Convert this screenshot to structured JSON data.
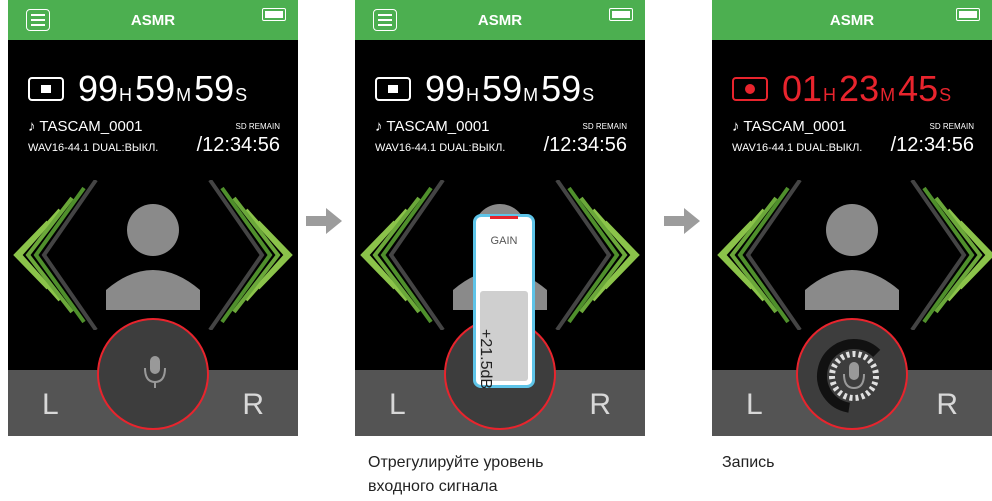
{
  "app_title": "ASMR",
  "screens": [
    {
      "counter": {
        "h": "99",
        "h_unit": "H",
        "m": "59",
        "m_unit": "M",
        "s": "59",
        "s_unit": "S"
      }
    },
    {
      "counter": {
        "h": "99",
        "h_unit": "H",
        "m": "59",
        "m_unit": "M",
        "s": "59",
        "s_unit": "S"
      }
    },
    {
      "counter": {
        "h": "01",
        "h_unit": "H",
        "m": "23",
        "m_unit": "M",
        "s": "45",
        "s_unit": "S"
      }
    }
  ],
  "file": {
    "name": "♪ TASCAM_0001",
    "format": "WAV16-44.1 DUAL:ВЫКЛ."
  },
  "sd": {
    "label": "SD REMAIN",
    "remain": "/12:34:56"
  },
  "channels": {
    "left": "L",
    "right": "R"
  },
  "gain": {
    "label": "GAIN",
    "value": "+21.5dB"
  },
  "captions": {
    "adjust_line1": "Отрегулируйте уровень",
    "adjust_line2": "входного сигнала",
    "record": "Запись"
  },
  "colors": {
    "bar": "#4caf50",
    "record": "#e8242d",
    "wave": "#8bc34a",
    "popup_border": "#5ec4e8"
  }
}
